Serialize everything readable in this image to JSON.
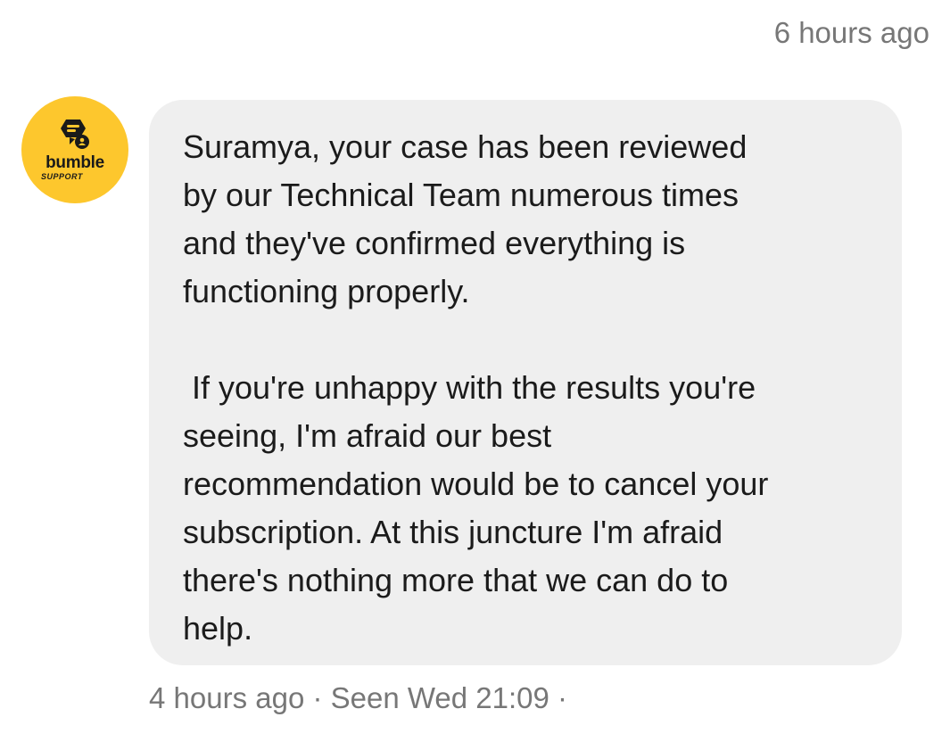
{
  "top_timestamp": "6 hours ago",
  "sender": {
    "brand": "bumble",
    "brand_sub": "SUPPORT",
    "avatar_color": "#fdc72d",
    "icon": "bumble-support-logo-icon"
  },
  "message": {
    "paragraph1": "Suramya, your case has been reviewed\nby our Technical Team numerous times\nand they've confirmed everything is\nfunctioning properly.",
    "paragraph2": " If you're unhappy with the results you're\nseeing, I'm afraid our best\nrecommendation would be to cancel your\nsubscription. At this juncture I'm afraid\nthere's nothing more that we can do to\nhelp.",
    "bubble_color": "#efefef"
  },
  "meta": {
    "text": "4 hours ago · Seen Wed 21:09 ·"
  },
  "colors": {
    "previous_bubble_border": "#1f6fd6",
    "meta_text": "#777777"
  }
}
